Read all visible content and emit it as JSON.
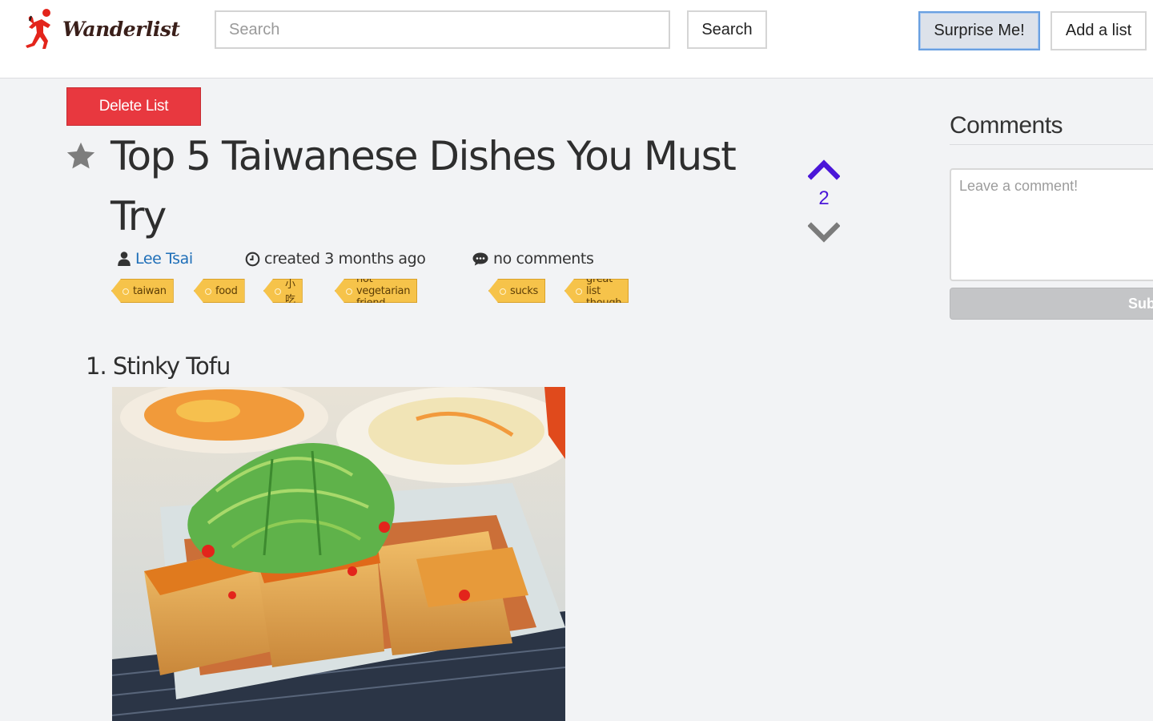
{
  "header": {
    "logo_text": "Wanderlist",
    "search_placeholder": "Search",
    "search_button": "Search",
    "surprise_button": "Surprise Me!",
    "add_list_button": "Add a list"
  },
  "list": {
    "delete_button": "Delete List",
    "title": "Top 5 Taiwanese Dishes You Must Try",
    "author": "Lee Tsai",
    "created": "created 3 months ago",
    "comments_count": "no comments",
    "tags": [
      "taiwan",
      "food",
      "小吃",
      "not vegetarian friend",
      "sucks",
      "great list though"
    ],
    "votes": "2",
    "items": [
      {
        "heading": "1. Stinky Tofu"
      }
    ]
  },
  "comments": {
    "title": "Comments",
    "placeholder": "Leave a comment!",
    "submit_label": "Sub"
  },
  "colors": {
    "delete": "#e8383f",
    "link": "#1f6fb8",
    "vote_up": "#4a16d8",
    "tag": "#f6c34a",
    "background": "#f2f3f5"
  },
  "icons": [
    "logo-runner-icon",
    "star-icon",
    "user-icon",
    "clock-icon",
    "comment-icon",
    "tag-icon",
    "chevron-up-icon",
    "chevron-down-icon"
  ]
}
